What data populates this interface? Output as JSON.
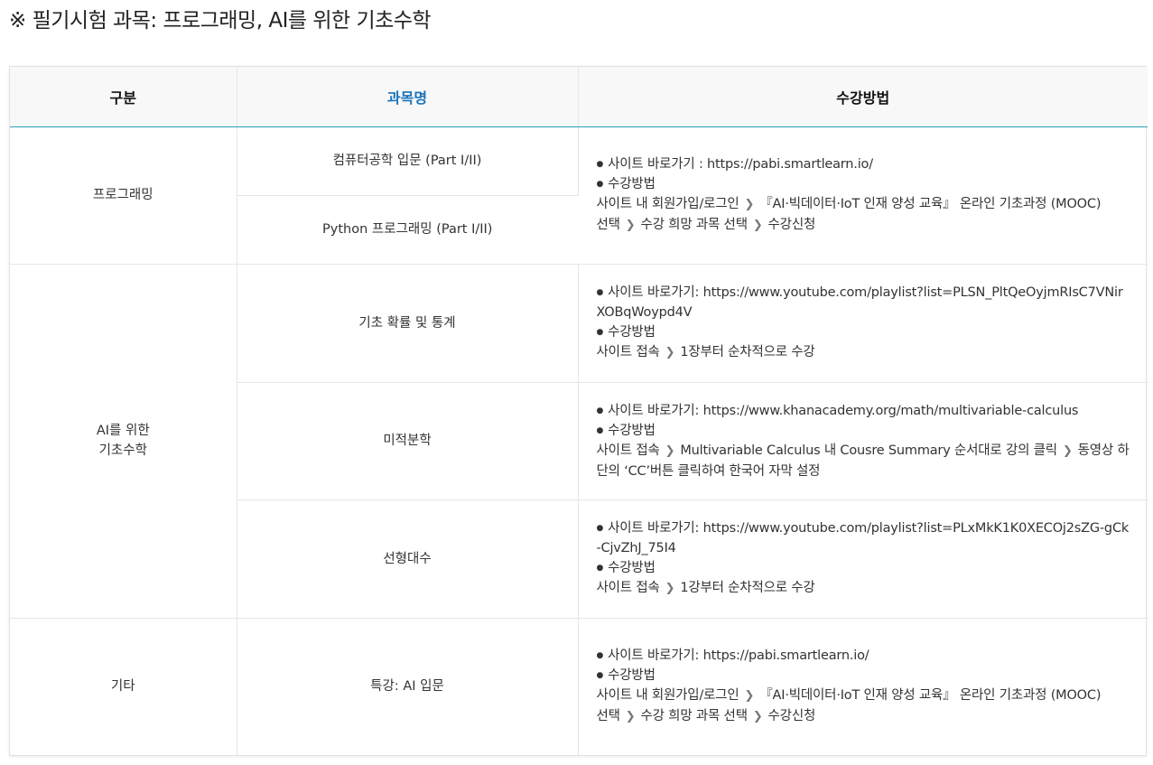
{
  "page": {
    "title": "※ 필기시험 과목: 프로그래밍, AI를 위한 기초수학"
  },
  "table": {
    "headers": [
      "구분",
      "과목명",
      "수강방법"
    ],
    "categories": {
      "programming": "프로그래밍",
      "math_line1": "AI를 위한",
      "math_line2": "기초수학",
      "etc": "기타"
    },
    "subjects": {
      "cs_intro": "컴퓨터공학 입문 (Part I/II)",
      "python": "Python 프로그래밍 (Part I/II)",
      "probability": "기초 확률 및 통계",
      "calculus": "미적분학",
      "linear_algebra": "선형대수",
      "ai_intro": "특강: AI 입문"
    },
    "methods": {
      "prog": {
        "site": "사이트 바로가기 : https://pabi.smartlearn.io/",
        "how": "수강방법",
        "step1": "사이트 내 회원가입/로그인",
        "step2a": "『AI·빅데이터·IoT 인재 양성 교육』 온라인 기초과정 (MOOC)",
        "step2b": "선택",
        "step3": "수강 희망 과목 선택",
        "step4": "수강신청"
      },
      "prob": {
        "site": "사이트 바로가기: https://www.youtube.com/playlist?list=PLSN_PltQeOyjmRIsC7VNirXOBqWoypd4V",
        "how": "수강방법",
        "step1": "사이트 접속",
        "step2": "1장부터 순차적으로 수강"
      },
      "calc": {
        "site": "사이트 바로가기: https://www.khanacademy.org/math/multivariable-calculus",
        "how": "수강방법",
        "step1": "사이트 접속",
        "step2": "Multivariable Calculus 내 Cousre Summary 순서대로 강의 클릭",
        "step3": "동영상 하단의 ‘CC’버튼 클릭하여 한국어 자막 설정"
      },
      "linalg": {
        "site": "사이트 바로가기: https://www.youtube.com/playlist?list=PLxMkK1K0XECOj2sZG-gCk-CjvZhJ_75I4",
        "how": "수강방법",
        "step1": "사이트 접속",
        "step2": "1강부터 순차적으로 수강"
      },
      "etc": {
        "site": "사이트 바로가기: https://pabi.smartlearn.io/",
        "how": "수강방법",
        "step1": "사이트 내 회원가입/로그인",
        "step2a": "『AI·빅데이터·IoT 인재 양성 교육』 온라인 기초과정 (MOOC)",
        "step2b": "선택",
        "step3": "수강 희망 과목 선택",
        "step4": "수강신청"
      }
    },
    "colors": {
      "header_accent": "#1a73b8",
      "header_divider": "#2aa3b8",
      "header_bg": "#f8f8f8"
    }
  }
}
